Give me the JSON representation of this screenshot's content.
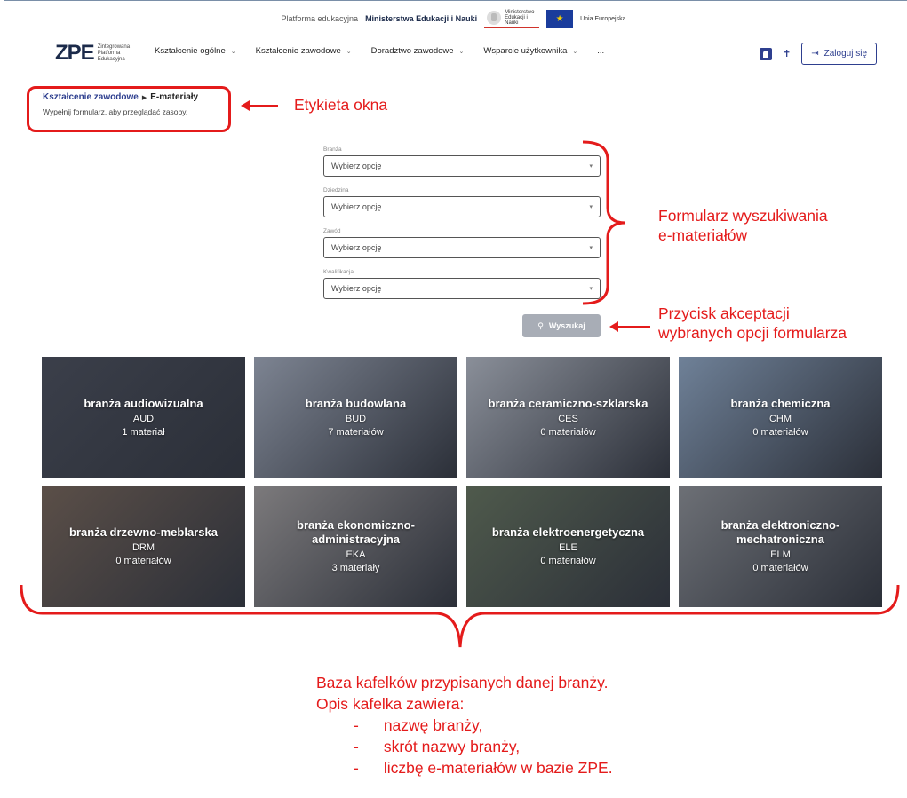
{
  "top_strip": {
    "platform_prefix": "Platforma edukacyjna",
    "platform_ministry": "Ministerstwa Edukacji i Nauki",
    "ministry_badge": "Ministerstwo Edukacji i Nauki",
    "eu_label": "Unia Europejska"
  },
  "header": {
    "logo_mark": "ZPE",
    "logo_text": "Zintegrowana Platforma Edukacyjna",
    "nav": [
      {
        "label": "Kształcenie ogólne"
      },
      {
        "label": "Kształcenie zawodowe"
      },
      {
        "label": "Doradztwo zawodowe"
      },
      {
        "label": "Wsparcie użytkownika"
      },
      {
        "label": "..."
      }
    ],
    "login_label": "Zaloguj się"
  },
  "breadcrumb": {
    "link": "Kształcenie zawodowe",
    "current": "E-materiały",
    "subtitle": "Wypełnij formularz, aby przeglądać zasoby."
  },
  "form": {
    "fields": [
      {
        "label": "Branża",
        "placeholder": "Wybierz opcję"
      },
      {
        "label": "Dziedzina",
        "placeholder": "Wybierz opcję"
      },
      {
        "label": "Zawód",
        "placeholder": "Wybierz opcję"
      },
      {
        "label": "Kwalifikacja",
        "placeholder": "Wybierz opcję"
      }
    ],
    "search_label": "Wyszukaj"
  },
  "tiles": [
    {
      "name": "branża audiowizualna",
      "code": "AUD",
      "count": "1 materiał",
      "color": "#3b3f4a"
    },
    {
      "name": "branża budowlana",
      "code": "BUD",
      "count": "7 materiałów",
      "color": "#7d8492"
    },
    {
      "name": "branża ceramiczno-szklarska",
      "code": "CES",
      "count": "0 materiałów",
      "color": "#8a8f99"
    },
    {
      "name": "branża chemiczna",
      "code": "CHM",
      "count": "0 materiałów",
      "color": "#6f8198"
    },
    {
      "name": "branża drzewno-meblarska",
      "code": "DRM",
      "count": "0 materiałów",
      "color": "#5b4f48"
    },
    {
      "name": "branża ekonomiczno-administracyjna",
      "code": "EKA",
      "count": "3 materiały",
      "color": "#7c7a7c"
    },
    {
      "name": "branża elektroenergetyczna",
      "code": "ELE",
      "count": "0 materiałów",
      "color": "#4f5a4c"
    },
    {
      "name": "branża elektroniczno-mechatroniczna",
      "code": "ELM",
      "count": "0 materiałów",
      "color": "#6d7076"
    }
  ],
  "annotations": {
    "window_label": "Etykieta okna",
    "form_label_1": "Formularz wyszukiwania",
    "form_label_2": "e-materiałów",
    "button_label_1": "Przycisk akceptacji",
    "button_label_2": "wybranych opcji formularza",
    "tiles_line_1": "Baza kafelków przypisanych danej branży.",
    "tiles_line_2": "Opis kafelka zawiera:",
    "tiles_list": [
      "nazwę branży,",
      "skrót nazwy branży,",
      "liczbę e-materiałów w bazie ZPE."
    ]
  },
  "colors": {
    "accent_red": "#e41b1b",
    "brand_navy": "#2e3f8f",
    "button_grey": "#a8adb6"
  }
}
